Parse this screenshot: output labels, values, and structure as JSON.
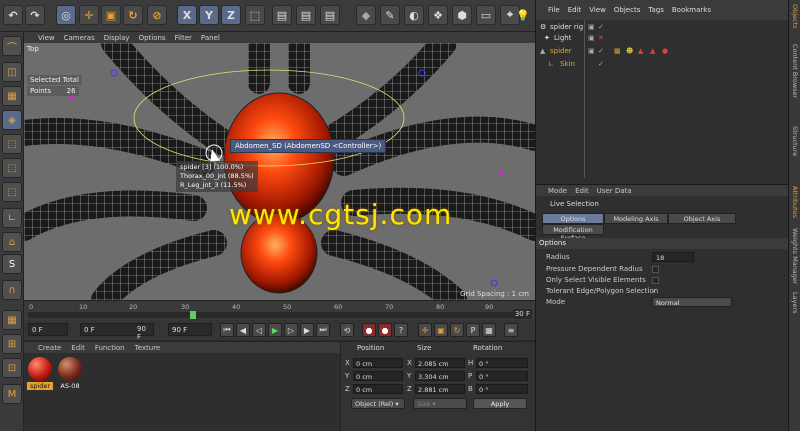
{
  "toolbar": {
    "axis_x": "X",
    "axis_y": "Y",
    "axis_z": "Z"
  },
  "viewport": {
    "menu": [
      "View",
      "Cameras",
      "Display",
      "Options",
      "Filter",
      "Panel"
    ],
    "label": "Top",
    "selected_total": "Selected Total",
    "points_label": "Points",
    "points_value": "26",
    "tooltip_main": "Abdomen_SD (AbdomenSD <Controller>)",
    "tooltip_lines": [
      "spider [3] (100.0%)",
      "Thorax_00_jnt (88.5%)",
      "R_Leg_jnt_3 (11.5%)"
    ],
    "grid_spacing": "Grid Spacing : 1 cm",
    "watermark": "www.cgtsj.com"
  },
  "timeline": {
    "ticks": [
      "0",
      "10",
      "20",
      "30",
      "40",
      "50",
      "60",
      "70",
      "80",
      "90"
    ],
    "current_frame": 30,
    "max_frame": 90,
    "end_label": "30 F"
  },
  "transport": {
    "field1": "0 F",
    "field2": "0 F",
    "field3": "90 F",
    "field4": "90 F"
  },
  "materials": {
    "menu": [
      "Create",
      "Edit",
      "Function",
      "Texture"
    ],
    "items": [
      {
        "name": "spider"
      },
      {
        "name": "AS-08"
      }
    ]
  },
  "coordinates": {
    "headers": [
      "Position",
      "Size",
      "Rotation"
    ],
    "rows": [
      {
        "axis": "X",
        "pos": "0 cm",
        "size_axis": "X",
        "size": "2.085 cm",
        "rot_axis": "H",
        "rot": "0 °"
      },
      {
        "axis": "Y",
        "pos": "0 cm",
        "size_axis": "Y",
        "size": "3.304 cm",
        "rot_axis": "P",
        "rot": "0 °"
      },
      {
        "axis": "Z",
        "pos": "0 cm",
        "size_axis": "Z",
        "size": "2.881 cm",
        "rot_axis": "B",
        "rot": "0 °"
      }
    ],
    "mode_select": "Object (Rel)",
    "size_select": "Size",
    "apply": "Apply"
  },
  "object_manager": {
    "menu": [
      "File",
      "Edit",
      "View",
      "Objects",
      "Tags",
      "Bookmarks"
    ],
    "objects": [
      {
        "name": "spider rig",
        "selected": false
      },
      {
        "name": "Light",
        "selected": false
      },
      {
        "name": "spider",
        "selected": true
      },
      {
        "name": "Skin",
        "selected": true
      }
    ]
  },
  "attribute_manager": {
    "menu": [
      "Mode",
      "Edit",
      "User Data"
    ],
    "title": "Live Selection",
    "tabs": [
      "Options",
      "Modeling Axis",
      "Object Axis",
      "Modification Surface"
    ],
    "section": "Options",
    "radius_label": "Radius",
    "radius_value": "18",
    "pressure_label": "Pressure Dependent Radius",
    "visible_label": "Only Select Visible Elements",
    "tolerant_label": "Tolerant Edge/Polygon Selection",
    "mode_label": "Mode",
    "mode_value": "Normal"
  },
  "right_tabs": [
    "Objects",
    "Content Browser",
    "Structure",
    "Attributes",
    "Weights Manager",
    "Layers"
  ],
  "colors": {
    "accent": "#e8a030",
    "check_green": "#5fdc5f"
  }
}
